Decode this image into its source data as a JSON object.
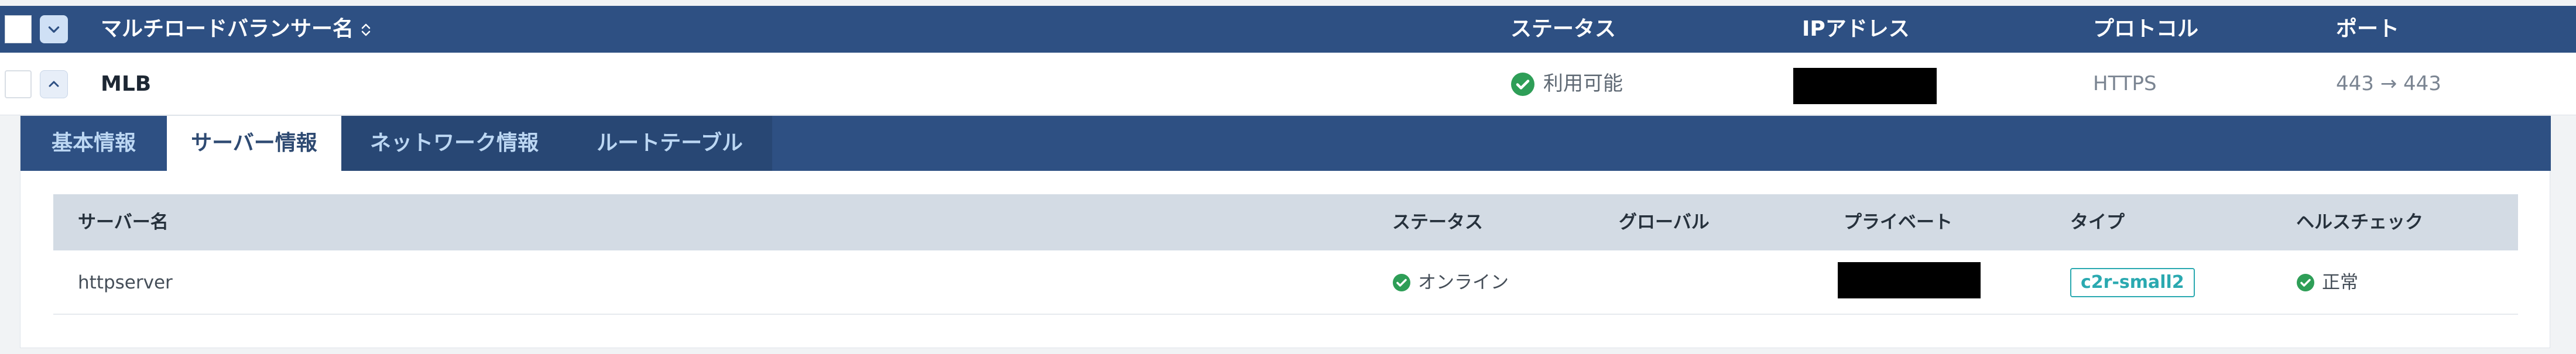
{
  "header": {
    "columns": {
      "name": "マルチロードバランサー名",
      "status": "ステータス",
      "ip": "IPアドレス",
      "protocol": "プロトコル",
      "port": "ポート"
    }
  },
  "lb_row": {
    "name": "MLB",
    "status": "利用可能",
    "protocol": "HTTPS",
    "port": "443 → 443"
  },
  "tabs": [
    "基本情報",
    "サーバー情報",
    "ネットワーク情報",
    "ルートテーブル"
  ],
  "active_tab": "サーバー情報",
  "server_table": {
    "headers": [
      "サーバー名",
      "ステータス",
      "グローバル",
      "プライベート",
      "タイプ",
      "ヘルスチェック"
    ],
    "rows": [
      {
        "name": "httpserver",
        "status": "オンライン",
        "global": "",
        "type": "c2r-small2",
        "health": "正常"
      }
    ]
  },
  "colors": {
    "header_bg": "#2e5083",
    "ok_green": "#2e9e57",
    "type_teal": "#2aa9b0"
  }
}
